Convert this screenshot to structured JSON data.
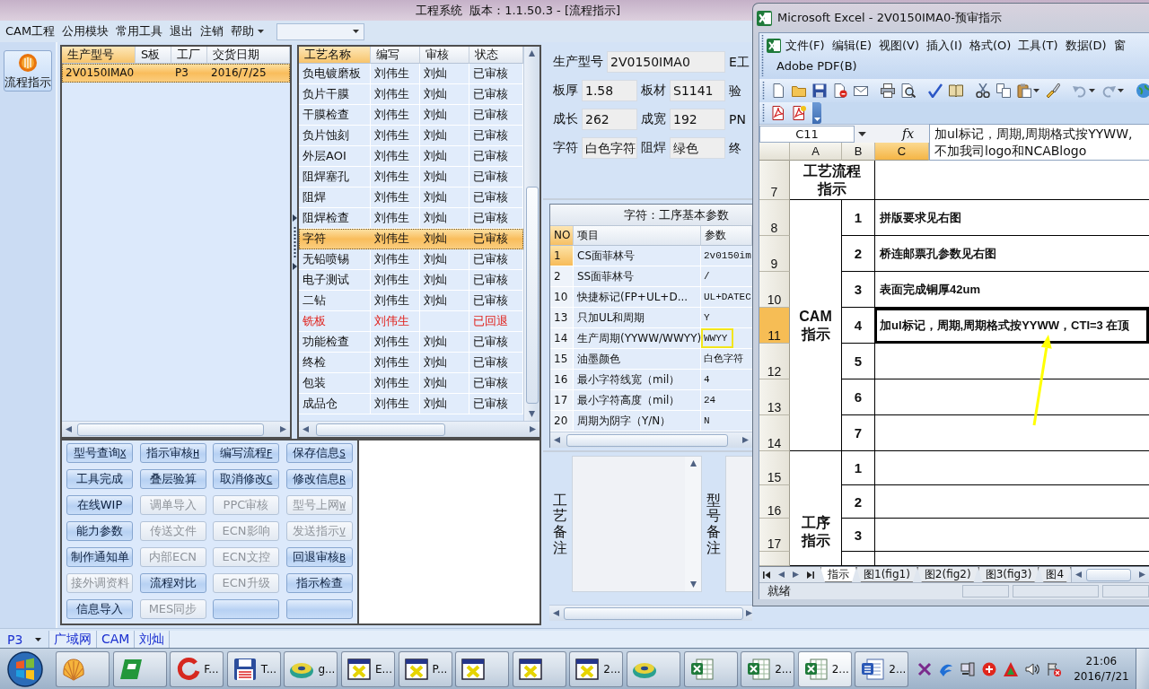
{
  "window": {
    "title": "工程系统  版本：1.1.50.3 - [流程指示]"
  },
  "menu": [
    "CAM工程",
    "公用模块",
    "常用工具",
    "退出",
    "注销",
    "帮助"
  ],
  "sidebar": {
    "items": [
      {
        "label": "流程指示"
      }
    ]
  },
  "orders_table": {
    "columns": [
      {
        "label": "生产型号",
        "selected": true
      },
      {
        "label": "S板",
        "selected": false
      },
      {
        "label": "工厂",
        "selected": false
      },
      {
        "label": "交货日期",
        "selected": false
      }
    ],
    "rows": [
      {
        "model_no": "2V0150IMA0",
        "factory": "P3",
        "delivery_date": "2016/7/25",
        "selected": true
      }
    ]
  },
  "process_table": {
    "columns": [
      {
        "label": "工艺名称",
        "selected": true
      },
      {
        "label": "编写",
        "selected": false
      },
      {
        "label": "审核",
        "selected": false
      },
      {
        "label": "状态",
        "selected": false
      }
    ],
    "rows": [
      {
        "process": "负电镀磨板",
        "author": "刘伟生",
        "reviewer": "刘灿",
        "status": "已审核",
        "returned": false,
        "selected": false
      },
      {
        "process": "负片干膜",
        "author": "刘伟生",
        "reviewer": "刘灿",
        "status": "已审核",
        "returned": false,
        "selected": false
      },
      {
        "process": "干膜检查",
        "author": "刘伟生",
        "reviewer": "刘灿",
        "status": "已审核",
        "returned": false,
        "selected": false
      },
      {
        "process": "负片蚀刻",
        "author": "刘伟生",
        "reviewer": "刘灿",
        "status": "已审核",
        "returned": false,
        "selected": false
      },
      {
        "process": "外层AOI",
        "author": "刘伟生",
        "reviewer": "刘灿",
        "status": "已审核",
        "returned": false,
        "selected": false
      },
      {
        "process": "阻焊塞孔",
        "author": "刘伟生",
        "reviewer": "刘灿",
        "status": "已审核",
        "returned": false,
        "selected": false
      },
      {
        "process": "阻焊",
        "author": "刘伟生",
        "reviewer": "刘灿",
        "status": "已审核",
        "returned": false,
        "selected": false
      },
      {
        "process": "阻焊检查",
        "author": "刘伟生",
        "reviewer": "刘灿",
        "status": "已审核",
        "returned": false,
        "selected": false
      },
      {
        "process": "字符",
        "author": "刘伟生",
        "reviewer": "刘灿",
        "status": "已审核",
        "returned": false,
        "selected": true
      },
      {
        "process": "无铅喷锡",
        "author": "刘伟生",
        "reviewer": "刘灿",
        "status": "已审核",
        "returned": false,
        "selected": false
      },
      {
        "process": "电子测试",
        "author": "刘伟生",
        "reviewer": "刘灿",
        "status": "已审核",
        "returned": false,
        "selected": false
      },
      {
        "process": "二钻",
        "author": "刘伟生",
        "reviewer": "刘灿",
        "status": "已审核",
        "returned": false,
        "selected": false
      },
      {
        "process": "铣板",
        "author": "刘伟生",
        "status": "已回退",
        "returned": true,
        "selected": false
      },
      {
        "process": "功能检查",
        "author": "刘伟生",
        "reviewer": "刘灿",
        "status": "已审核",
        "returned": false,
        "selected": false
      },
      {
        "process": "终检",
        "author": "刘伟生",
        "reviewer": "刘灿",
        "status": "已审核",
        "returned": false,
        "selected": false
      },
      {
        "process": "包装",
        "author": "刘伟生",
        "reviewer": "刘灿",
        "status": "已审核",
        "returned": false,
        "selected": false
      },
      {
        "process": "成品仓",
        "author": "刘伟生",
        "reviewer": "刘灿",
        "status": "已审核",
        "returned": false,
        "selected": false
      }
    ]
  },
  "info_panel": {
    "model_field": {
      "label": "生产型号",
      "value": "2V0150IMA0"
    },
    "rows": [
      [
        {
          "label": "板厚",
          "value": "1.58"
        },
        {
          "label": "板材",
          "value": "S1141"
        }
      ],
      [
        {
          "label": "成长",
          "value": "262"
        },
        {
          "label": "成宽",
          "value": "192"
        }
      ],
      [
        {
          "label": "字符",
          "value": "白色字符"
        },
        {
          "label": "阻焊",
          "value": "绿色"
        }
      ]
    ],
    "cut_column": [
      "E工",
      "验",
      "PN",
      "终"
    ]
  },
  "param_grid": {
    "title": "字符：工序基本参数",
    "columns": [
      {
        "label": "NO",
        "selected": true
      },
      {
        "label": "项目",
        "selected": false
      },
      {
        "label": "参数",
        "selected": false
      }
    ],
    "rows": [
      {
        "no": "1",
        "item": "CS面菲林号",
        "value": "2v0150im",
        "selected": true,
        "highlighted": false
      },
      {
        "no": "2",
        "item": "SS面菲林号",
        "value": "/",
        "selected": false,
        "highlighted": false
      },
      {
        "no": "10",
        "item": "快捷标记(FP+UL+D...",
        "value": "UL+DATEC",
        "selected": false,
        "highlighted": false
      },
      {
        "no": "13",
        "item": "只加UL和周期",
        "value": "Y",
        "selected": false,
        "highlighted": false
      },
      {
        "no": "14",
        "item": "生产周期(YYWW/WWYY)",
        "value": "WWYY",
        "selected": false,
        "highlighted": true
      },
      {
        "no": "15",
        "item": "油墨颜色",
        "value": "白色字符",
        "selected": false,
        "highlighted": false
      },
      {
        "no": "16",
        "item": "最小字符线宽（mil）",
        "value": "4",
        "selected": false,
        "highlighted": false
      },
      {
        "no": "17",
        "item": "最小字符高度（mil）",
        "value": "24",
        "selected": false,
        "highlighted": false
      },
      {
        "no": "20",
        "item": "周期为阴字（Y/N）",
        "value": "N",
        "selected": false,
        "highlighted": false
      }
    ]
  },
  "remarks": [
    {
      "label": "工艺备注"
    },
    {
      "label": "型号备注"
    }
  ],
  "action_buttons": [
    {
      "label": "型号查询",
      "hotkey": "X",
      "disabled": false
    },
    {
      "label": "指示审核",
      "hotkey": "H",
      "disabled": false
    },
    {
      "label": "编写流程",
      "hotkey": "F",
      "disabled": false
    },
    {
      "label": "保存信息",
      "hotkey": "S",
      "disabled": false
    },
    {
      "label": "工具完成",
      "disabled": false
    },
    {
      "label": "叠层验算",
      "disabled": false
    },
    {
      "label": "取消修改",
      "hotkey": "C",
      "disabled": false
    },
    {
      "label": "修改信息",
      "hotkey": "R",
      "disabled": false
    },
    {
      "label": "在线WIP",
      "disabled": false
    },
    {
      "label": "调单导入",
      "disabled": true
    },
    {
      "label": "PPC审核",
      "disabled": true
    },
    {
      "label": "型号上网",
      "hotkey": "W",
      "disabled": true
    },
    {
      "label": "能力参数",
      "disabled": false
    },
    {
      "label": "传送文件",
      "disabled": true
    },
    {
      "label": "ECN影响",
      "disabled": true
    },
    {
      "label": "发送指示",
      "hotkey": "V",
      "disabled": true
    },
    {
      "label": "制作通知单",
      "disabled": false
    },
    {
      "label": "内部ECN",
      "disabled": true
    },
    {
      "label": "ECN文控",
      "disabled": true
    },
    {
      "label": "回退审核",
      "hotkey": "B",
      "disabled": false
    },
    {
      "label": "接外调资料",
      "disabled": true
    },
    {
      "label": "流程对比",
      "disabled": false
    },
    {
      "label": "ECN升级",
      "disabled": true
    },
    {
      "label": "指示检查",
      "disabled": false
    },
    {
      "label": "信息导入",
      "disabled": false
    },
    {
      "label": "MES同步",
      "disabled": true
    },
    {
      "disabled": false
    },
    {
      "disabled": false
    }
  ],
  "status_bar": {
    "plant": "P3",
    "cells": [
      "广域网",
      "CAM",
      "刘灿"
    ]
  },
  "excel": {
    "title": "Microsoft Excel - 2V0150IMA0-预审指示",
    "menu_rows": [
      [
        "文件(F)",
        "编辑(E)",
        "视图(V)",
        "插入(I)",
        "格式(O)",
        "工具(T)",
        "数据(D)",
        "窗"
      ],
      [
        "Adobe PDF(B)"
      ]
    ],
    "name_box": "C11",
    "formula_label": "fx",
    "formula_lines": [
      "加ul标记，周期,周期格式按YYWW,",
      "不加我司logo和NCABlogo"
    ],
    "columns": [
      {
        "label": "A",
        "selected": false
      },
      {
        "label": "B",
        "selected": false
      },
      {
        "label": "C",
        "selected": true
      }
    ],
    "row_headers": [
      {
        "label": "7",
        "selected": false
      },
      {
        "label": "8",
        "selected": false
      },
      {
        "label": "9",
        "selected": false
      },
      {
        "label": "10",
        "selected": false
      },
      {
        "label": "11",
        "selected": true
      },
      {
        "label": "12",
        "selected": false
      },
      {
        "label": "13",
        "selected": false
      },
      {
        "label": "14",
        "selected": false
      },
      {
        "label": "15",
        "selected": false
      },
      {
        "label": "16",
        "selected": false
      },
      {
        "label": "17",
        "selected": false
      }
    ],
    "heading_lines": [
      "工艺流程",
      "指示"
    ],
    "groups": [
      {
        "title_lines": [
          "CAM",
          "指示"
        ],
        "items": [
          {
            "no": "1",
            "text": "拼版要求见右图"
          },
          {
            "no": "2",
            "text": "桥连邮票孔参数见右图"
          },
          {
            "no": "3",
            "text": "表面完成铜厚42um"
          },
          {
            "no": "4",
            "text": "加ul标记，周期,周期格式按YYWW，CTI=3 在顶"
          },
          {
            "no": "5"
          },
          {
            "no": "6"
          },
          {
            "no": "7"
          }
        ]
      },
      {
        "title_lines": [
          "工序",
          "指示"
        ],
        "items": [
          {
            "no": "1"
          },
          {
            "no": "2"
          },
          {
            "no": "3"
          }
        ]
      }
    ],
    "sheet_tabs": [
      {
        "label": "指示",
        "selected": true
      },
      {
        "label": "图1(fig1)",
        "selected": false
      },
      {
        "label": "图2(fig2)",
        "selected": false
      },
      {
        "label": "图3(fig3)",
        "selected": false
      },
      {
        "label": "图4",
        "selected": false
      }
    ],
    "status": "就绪"
  },
  "taskbar": {
    "buttons": [
      {
        "kind": "shell",
        "active": false
      },
      {
        "kind": "p-logo",
        "active": false
      },
      {
        "kind": "g-logo",
        "label": "F...",
        "active": false
      },
      {
        "kind": "floppy",
        "label": "T...",
        "active": false
      },
      {
        "kind": "disc",
        "label": "g...",
        "active": false
      },
      {
        "kind": "window",
        "label": "E...",
        "active": false
      },
      {
        "kind": "window",
        "label": "P...",
        "active": false
      },
      {
        "kind": "window",
        "active": false
      },
      {
        "kind": "window",
        "active": false
      },
      {
        "kind": "window",
        "label": "2...",
        "active": false
      },
      {
        "kind": "disc",
        "active": false
      },
      {
        "kind": "excel",
        "active": false
      },
      {
        "kind": "excel",
        "label": "2...",
        "active": false
      },
      {
        "kind": "excel",
        "label": "2...",
        "active": true
      },
      {
        "kind": "word",
        "label": "2...",
        "active": false
      }
    ],
    "clock": {
      "time": "21:06",
      "date": "2016/7/21"
    }
  }
}
